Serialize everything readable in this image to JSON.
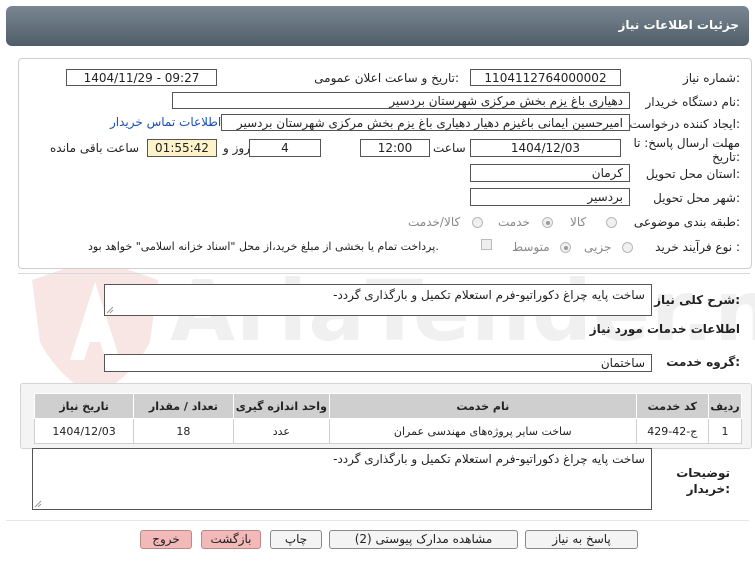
{
  "header": {
    "title": "جزئیات اطلاعات نیاز"
  },
  "need": {
    "number_label": "شماره نیاز:",
    "number_value": "1104112764000002",
    "announce_label": "تاریخ و ساعت اعلان عمومی:",
    "announce_value": "1404/11/29 - 09:27",
    "buyer_org_label": "نام دستگاه خریدار:",
    "buyer_org_value": "دهیاری باغ یزم بخش مرکزی شهرستان بردسیر",
    "creator_label": "ایجاد کننده درخواست:",
    "creator_value": "امیرحسین ایمانی باغیزم دهیار دهیاری باغ یزم بخش مرکزی شهرستان بردسیر",
    "contact_link": "اطلاعات تماس خریدار",
    "deadline_label_line1": "مهلت ارسال پاسخ: تا",
    "deadline_label_line2": "تاریخ:",
    "deadline_date": "1404/12/03",
    "time_label": "ساعت",
    "deadline_time": "12:00",
    "days_value": "4",
    "days_label": "روز و",
    "remaining_time": "01:55:42",
    "remaining_label": "ساعت باقی مانده",
    "province_label": "استان محل تحویل:",
    "province_value": "کرمان",
    "city_label": "شهر محل تحویل:",
    "city_value": "بردسیر",
    "category_label": "طبقه بندی موضوعی:",
    "category_options": [
      "کالا",
      "خدمت",
      "کالا/خدمت"
    ],
    "process_label": "نوع فرآیند خرید :",
    "process_options": [
      "جزیی",
      "متوسط"
    ],
    "payment_note": "پرداخت تمام یا بخشی از مبلغ خرید،از محل \"اسناد خزانه اسلامی\" خواهد بود."
  },
  "summary": {
    "label": "شرح کلی نیاز:",
    "value": "ساخت پایه چراغ دکوراتیو-فرم استعلام تکمیل و بارگذاری گردد-"
  },
  "services": {
    "section_title": "اطلاعات خدمات مورد نیاز",
    "group_label": "گروه خدمت:",
    "group_value": "ساختمان",
    "columns": [
      "ردیف",
      "کد خدمت",
      "نام خدمت",
      "واحد اندازه گیری",
      "تعداد / مقدار",
      "تاریخ نیاز"
    ],
    "rows": [
      {
        "row": "1",
        "code": "ج-42-429",
        "name": "ساخت سایر پروژه‌های مهندسی عمران",
        "unit": "عدد",
        "qty": "18",
        "date": "1404/12/03"
      }
    ]
  },
  "buyer_notes": {
    "label_line1": "توضیحات",
    "label_line2": "خریدار:",
    "value": "ساخت پایه چراغ دکوراتیو-فرم استعلام تکمیل و بارگذاری گردد-"
  },
  "buttons": {
    "reply": "پاسخ به نیاز",
    "attachments": "مشاهده مدارک پیوستی (2)",
    "print": "چاپ",
    "back": "بازگشت",
    "exit": "خروج"
  },
  "watermark": {
    "text": "AriaTender.net"
  }
}
